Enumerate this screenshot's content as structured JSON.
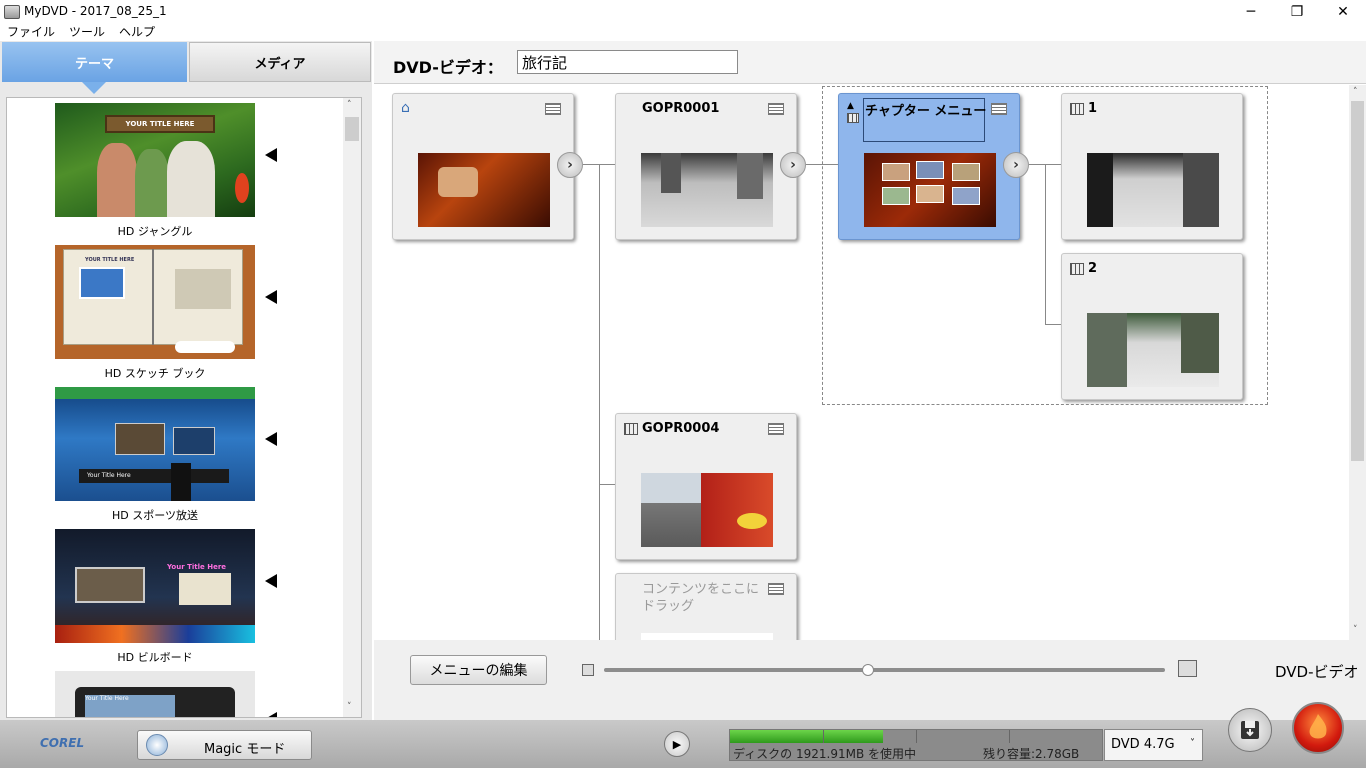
{
  "window": {
    "title": "MyDVD - 2017_08_25_1",
    "minimize": "─",
    "restore": "❐",
    "close": "✕"
  },
  "menu": [
    "ファイル",
    "ツール",
    "ヘルプ"
  ],
  "left_tabs": {
    "theme": "テーマ",
    "media": "メディア"
  },
  "themes": [
    {
      "label": "HD ジャングル",
      "thumb_title": "YOUR TITLE HERE"
    },
    {
      "label": "HD スケッチ ブック",
      "thumb_title": "YOUR TITLE HERE"
    },
    {
      "label": "HD スポーツ放送",
      "thumb_title": "Your Title Here"
    },
    {
      "label": "HD ビルボード",
      "thumb_title": "Your Title Here"
    },
    {
      "label": "",
      "thumb_title": "Your Title Here"
    }
  ],
  "header": {
    "format_label": "DVD-ビデオ：",
    "title_value": "旅行記"
  },
  "nodes": {
    "main_menu": {
      "title": ""
    },
    "gopr0001": {
      "title": "GOPR0001"
    },
    "chapter_menu": {
      "title": "チャプター メニュー"
    },
    "chapter_1": {
      "title": "1"
    },
    "chapter_2": {
      "title": "2"
    },
    "gopr0004": {
      "title": "GOPR0004"
    },
    "drop_zone": {
      "title": "コンテンツをここにドラッグ"
    }
  },
  "footer": {
    "edit_menu_label": "メニューの編集",
    "zoom_level": 0.47,
    "format_label": "DVD-ビデオ"
  },
  "statusbar": {
    "logo": "COREL",
    "magic_mode_label": "Magic モード",
    "usage_text": "ディスクの 1921.91MB を使用中",
    "remaining_text": "残り容量:2.78GB",
    "usage_fraction": 0.41,
    "disc_type": "DVD 4.7G"
  },
  "colors": {
    "accent": "#7ab0ea",
    "selected_node": "#8fb6ec",
    "usage_fill": "#3aa824"
  }
}
